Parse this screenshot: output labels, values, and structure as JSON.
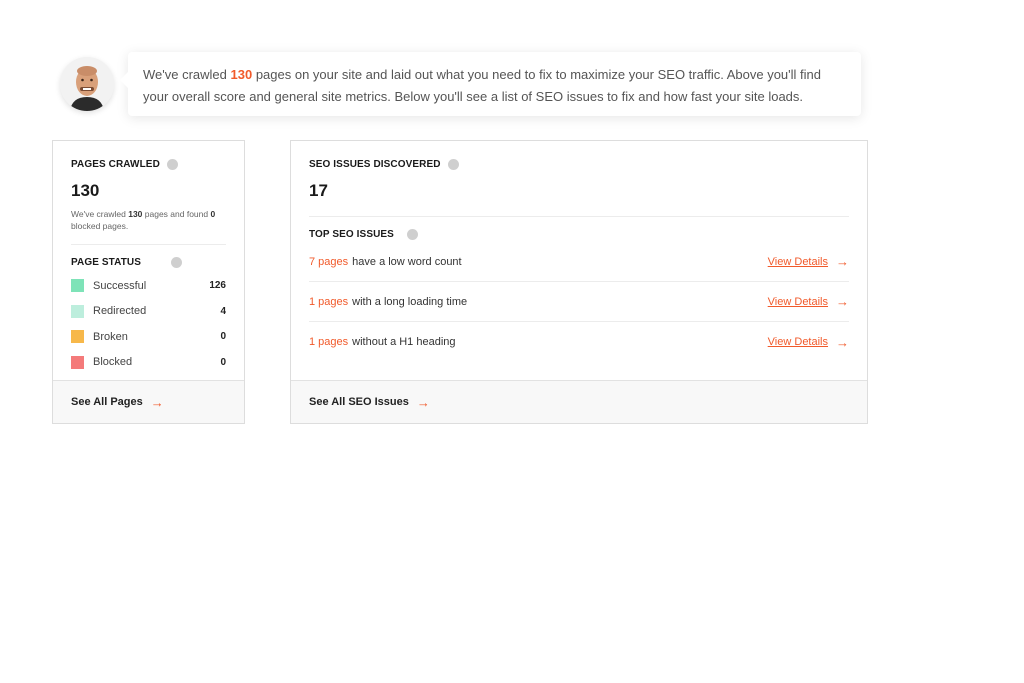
{
  "intro": {
    "before": "We've crawled ",
    "count": "130",
    "after": " pages on your site and laid out what you need to fix to maximize your SEO traffic. Above you'll find your overall score and general site metrics. Below you'll see a list of SEO issues to fix and how fast your site loads."
  },
  "pages_card": {
    "title": "PAGES CRAWLED",
    "count": "130",
    "desc_1": "We've crawled ",
    "desc_count": "130",
    "desc_2": " pages and found ",
    "desc_blocked": "0",
    "desc_3": " blocked pages.",
    "status_title": "PAGE STATUS",
    "statuses": [
      {
        "label": "Successful",
        "count": "126",
        "color": "#7ee3b8"
      },
      {
        "label": "Redirected",
        "count": "4",
        "color": "#bdeedd"
      },
      {
        "label": "Broken",
        "count": "0",
        "color": "#f7b84a"
      },
      {
        "label": "Blocked",
        "count": "0",
        "color": "#f47a7a"
      }
    ],
    "footer": "See All Pages"
  },
  "seo_card": {
    "title": "SEO ISSUES DISCOVERED",
    "count": "17",
    "top_title": "TOP SEO ISSUES",
    "issues": [
      {
        "pages": "7 pages",
        "text": "have a low word count",
        "link": "View Details"
      },
      {
        "pages": "1 pages",
        "text": "with a long loading time",
        "link": "View Details"
      },
      {
        "pages": "1 pages",
        "text": "without a H1 heading",
        "link": "View Details"
      }
    ],
    "footer": "See All SEO Issues"
  },
  "icons": {
    "arrow": "→",
    "info": "info-icon",
    "avatar": "avatar"
  },
  "colors": {
    "accent": "#f15a2b"
  }
}
